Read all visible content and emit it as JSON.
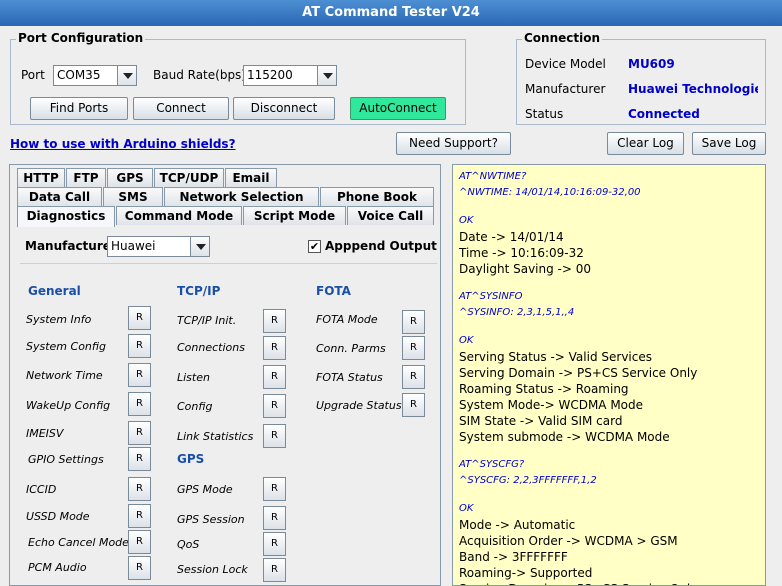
{
  "window": {
    "title": "AT Command Tester V24"
  },
  "port_config": {
    "title": "Port Configuration",
    "port_label": "Port",
    "port_value": "COM35",
    "baud_label": "Baud Rate(bps)",
    "baud_value": "115200",
    "buttons": {
      "find": "Find Ports",
      "connect": "Connect",
      "disconnect": "Disconnect",
      "auto": "AutoConnect"
    }
  },
  "connection": {
    "title": "Connection",
    "device_label": "Device Model",
    "device_value": "MU609",
    "manufacturer_label": "Manufacturer",
    "manufacturer_value": "Huawei Technologie...",
    "status_label": "Status",
    "status_value": "Connected"
  },
  "toolbar": {
    "arduino_link": "How to use with Arduino shields?",
    "support": "Need Support?",
    "clear_log": "Clear Log",
    "save_log": "Save Log"
  },
  "tabs": {
    "row1": [
      "HTTP",
      "FTP",
      "GPS",
      "TCP/UDP",
      "Email"
    ],
    "row2": [
      "Data Call",
      "SMS",
      "Network Selection",
      "Phone Book"
    ],
    "row3": [
      "Diagnostics",
      "Command Mode",
      "Script Mode",
      "Voice Call"
    ]
  },
  "diagnostics": {
    "manufacturer_label": "Manufacturer",
    "manufacturer_value": "Huawei",
    "append_label": "Apppend Output",
    "append_checked": "✔",
    "button_label": "R",
    "sections": {
      "general": "General",
      "tcpip": "TCP/IP",
      "fota": "FOTA",
      "gps": "GPS"
    },
    "general": [
      "System Info",
      "System Config",
      "Network Time",
      "WakeUp Config",
      "IMEISV",
      "GPIO Settings",
      "ICCID",
      "USSD Mode",
      "Echo Cancel Mode",
      "PCM Audio"
    ],
    "tcpip": [
      "TCP/IP Init.",
      "Connections",
      "Listen",
      "Config",
      "Link Statistics"
    ],
    "gps": [
      "GPS Mode",
      "GPS Session",
      "QoS",
      "Session Lock"
    ],
    "fota": [
      "FOTA Mode",
      "Conn. Parms",
      "FOTA Status",
      "Upgrade Status"
    ]
  },
  "log": [
    {
      "t": "AT^NWTIME?",
      "c": true
    },
    {
      "t": "^NWTIME: 14/01/14,10:16:09-32,00",
      "c": true
    },
    {
      "t": "",
      "c": false
    },
    {
      "t": "OK",
      "c": true
    },
    {
      "t": "Date ->  14/01/14",
      "c": false
    },
    {
      "t": "Time -> 10:16:09-32",
      "c": false
    },
    {
      "t": "Daylight Saving -> 00",
      "c": false
    },
    {
      "t": "",
      "c": false
    },
    {
      "t": "AT^SYSINFO",
      "c": true
    },
    {
      "t": "^SYSINFO: 2,3,1,5,1,,4",
      "c": true
    },
    {
      "t": "",
      "c": false
    },
    {
      "t": "OK",
      "c": true
    },
    {
      "t": "Serving Status -> Valid Services",
      "c": false
    },
    {
      "t": "Serving Domain -> PS+CS Service Only",
      "c": false
    },
    {
      "t": "Roaming Status -> Roaming",
      "c": false
    },
    {
      "t": "System Mode-> WCDMA Mode",
      "c": false
    },
    {
      "t": "SIM State -> Valid SIM card",
      "c": false
    },
    {
      "t": "System submode -> WCDMA Mode",
      "c": false
    },
    {
      "t": "",
      "c": false
    },
    {
      "t": "AT^SYSCFG?",
      "c": true
    },
    {
      "t": "^SYSCFG: 2,2,3FFFFFFF,1,2",
      "c": true
    },
    {
      "t": "",
      "c": false
    },
    {
      "t": "OK",
      "c": true
    },
    {
      "t": "Mode -> Automatic",
      "c": false
    },
    {
      "t": "Acquisition Order -> WCDMA > GSM",
      "c": false
    },
    {
      "t": "Band -> 3FFFFFFF",
      "c": false
    },
    {
      "t": "Roaming-> Supported",
      "c": false
    },
    {
      "t": "Serving Domain -> PS+CS Service Only",
      "c": false
    }
  ]
}
